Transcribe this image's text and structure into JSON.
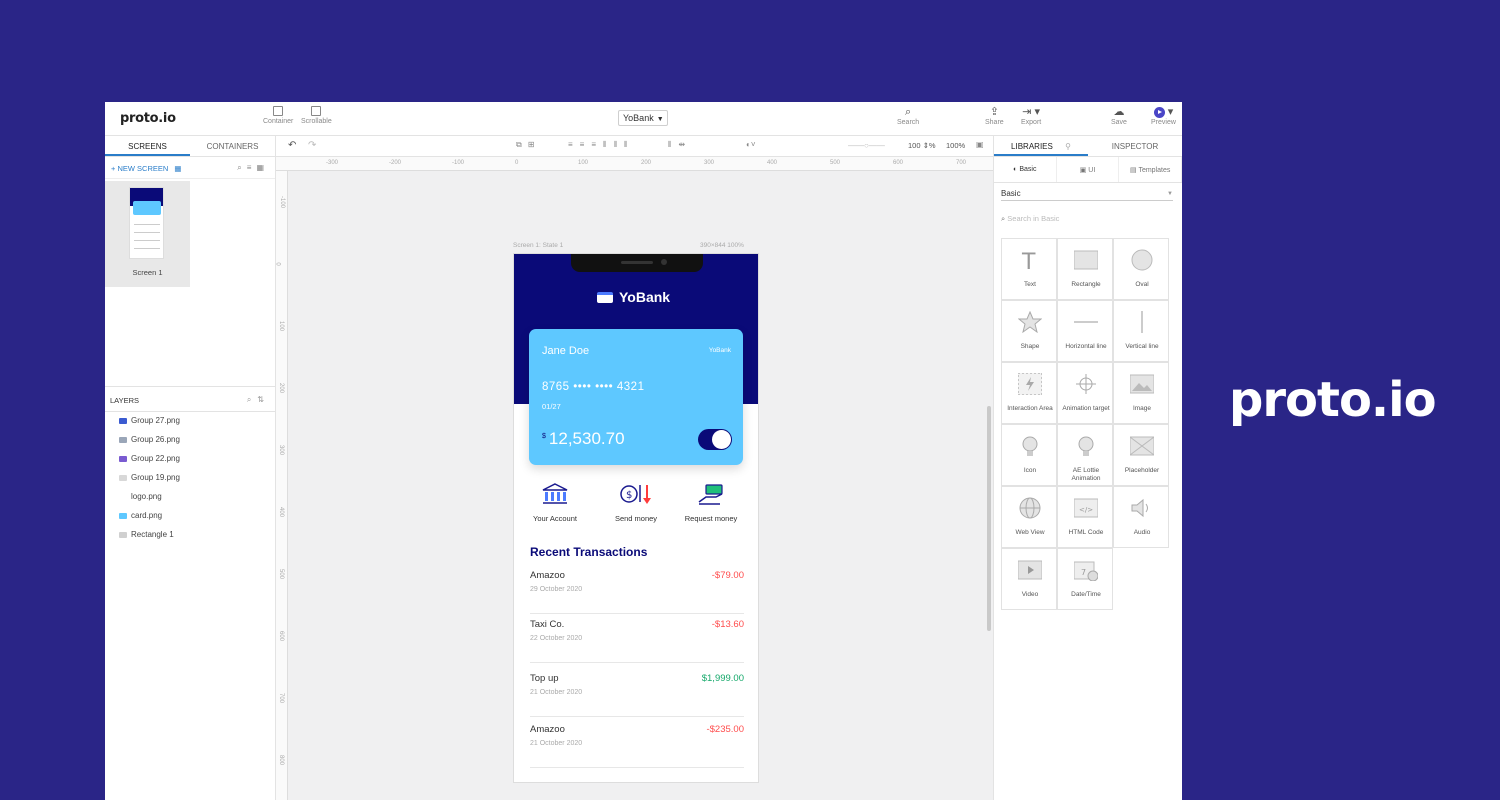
{
  "brand_text": "proto.io",
  "topbar": {
    "logo": "proto.io",
    "container_label": "Container",
    "scrollable_label": "Scrollable",
    "project": "YoBank",
    "search_label": "Search",
    "share_label": "Share",
    "export_label": "Export",
    "save_label": "Save",
    "preview_label": "Preview"
  },
  "left": {
    "tabs": [
      "SCREENS",
      "CONTAINERS"
    ],
    "new_screen": "NEW SCREEN",
    "screen_name": "Screen 1",
    "layers_title": "LAYERS",
    "layers": [
      {
        "name": "Group 27.png",
        "color": "#3b5bd1"
      },
      {
        "name": "Group 26.png",
        "color": "#9aa6b8"
      },
      {
        "name": "Group 22.png",
        "color": "#7a5bd1"
      },
      {
        "name": "Group 19.png",
        "color": "#d8d8d8"
      },
      {
        "name": "logo.png",
        "color": "#ffffff"
      },
      {
        "name": "card.png",
        "color": "#5ec8ff"
      },
      {
        "name": "Rectangle 1",
        "color": "#d0d0d0"
      }
    ]
  },
  "canvas": {
    "zoom_value": "100",
    "zoom_pct": "%",
    "zoom_reset": "100%",
    "state_label": "Screen 1: State 1",
    "state_size": "390×844 100%",
    "ruler_top": [
      "-300",
      "-200",
      "-100",
      "0",
      "100",
      "200",
      "300",
      "400",
      "500",
      "600",
      "700"
    ],
    "ruler_left": [
      "-100",
      "0",
      "100",
      "200",
      "300",
      "400",
      "500",
      "600",
      "700",
      "800"
    ]
  },
  "phone": {
    "bank_name": "YoBank",
    "card": {
      "holder": "Jane Doe",
      "brand": "YoBank",
      "number": "8765 •••• •••• 4321",
      "expiry": "01/27",
      "currency": "$",
      "balance": "12,530.70"
    },
    "actions": [
      "Your Account",
      "Send money",
      "Request money"
    ],
    "recent_title": "Recent Transactions",
    "transactions": [
      {
        "name": "Amazoo",
        "date": "29 October 2020",
        "amount": "-$79.00",
        "type": "neg"
      },
      {
        "name": "Taxi Co.",
        "date": "22 October 2020",
        "amount": "-$13.60",
        "type": "neg"
      },
      {
        "name": "Top up",
        "date": "21 October 2020",
        "amount": "$1,999.00",
        "type": "pos"
      },
      {
        "name": "Amazoo",
        "date": "21 October 2020",
        "amount": "-$235.00",
        "type": "neg"
      }
    ]
  },
  "right": {
    "tabs": [
      "LIBRARIES",
      "INSPECTOR"
    ],
    "subtabs": [
      "Basic",
      "UI",
      "Templates"
    ],
    "library": "Basic",
    "search_placeholder": "Search in Basic",
    "components": [
      "Text",
      "Rectangle",
      "Oval",
      "Shape",
      "Horizontal line",
      "Vertical line",
      "Interaction Area",
      "Animation target",
      "Image",
      "Icon",
      "AE Lottie Animation",
      "Placeholder",
      "Web View",
      "HTML Code",
      "Audio",
      "Video",
      "Date/Time"
    ]
  }
}
